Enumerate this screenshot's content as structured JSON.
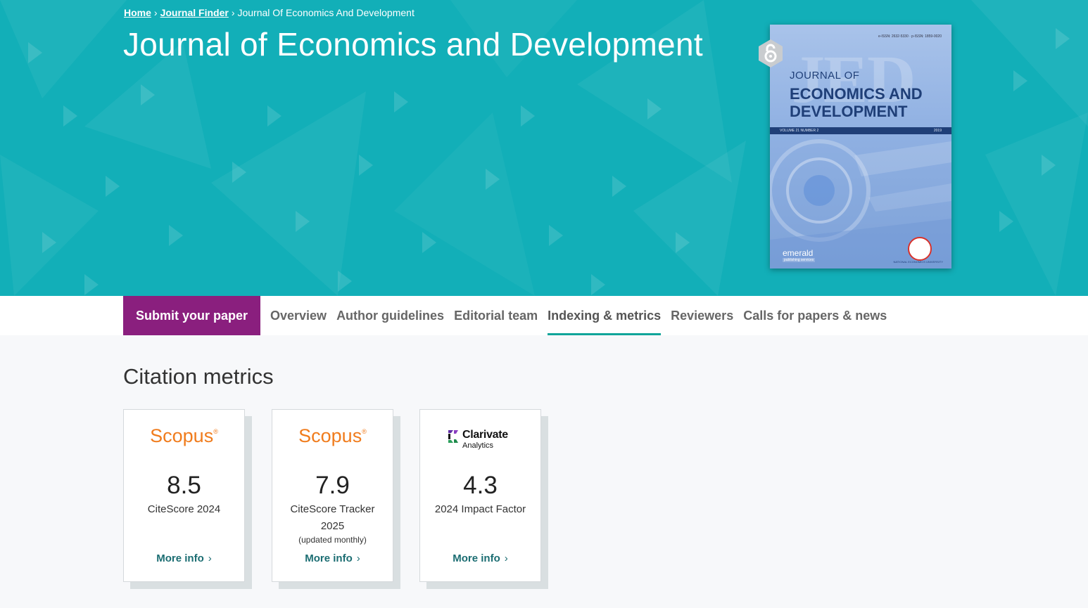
{
  "breadcrumb": {
    "home": "Home",
    "journal_finder": "Journal Finder",
    "current": "Journal Of Economics And Development",
    "separator": "›"
  },
  "page_title": "Journal of Economics and Development",
  "cover": {
    "big_text": "JED",
    "issn": "e-ISSN: 2632-5330 · p-ISSN: 1859-0020",
    "journal_of": "JOURNAL OF",
    "main_title": "ECONOMICS AND DEVELOPMENT",
    "volume": "VOLUME 21 NUMBER 2",
    "year": "2019",
    "publisher": "emerald",
    "publisher_sub": "publishing services",
    "university": "NATIONAL ECONOMICS UNIVERSITY"
  },
  "oa_badge_icon": "open-access-icon",
  "tabbar": {
    "submit_label": "Submit your paper",
    "tabs": [
      {
        "label": "Overview",
        "active": false
      },
      {
        "label": "Author guidelines",
        "active": false
      },
      {
        "label": "Editorial team",
        "active": false
      },
      {
        "label": "Indexing & metrics",
        "active": true
      },
      {
        "label": "Reviewers",
        "active": false
      },
      {
        "label": "Calls for papers & news",
        "active": false
      }
    ]
  },
  "citation_metrics": {
    "title": "Citation metrics",
    "cards": [
      {
        "logo": "Scopus",
        "value": "8.5",
        "label": "CiteScore 2024",
        "note": "",
        "more": "More info"
      },
      {
        "logo": "Scopus",
        "value": "7.9",
        "label": "CiteScore Tracker 2025",
        "note": "(updated monthly)",
        "more": "More info"
      },
      {
        "logo_name": "Clarivate",
        "logo_sub": "Analytics",
        "value": "4.3",
        "label": "2024 Impact Factor",
        "note": "",
        "more": "More info"
      }
    ]
  },
  "colors": {
    "hero_bg": "#12afb8",
    "submit_bg": "#8a1f7e",
    "active_tab_underline": "#11a59a",
    "scopus_orange": "#f07c1d",
    "link_teal": "#1b6d72"
  }
}
